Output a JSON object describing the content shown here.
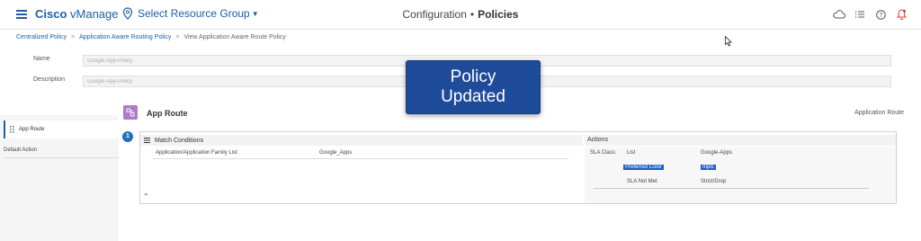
{
  "header": {
    "brand_bold": "Cisco",
    "brand_rest": " vManage",
    "resource_group": "Select Resource Group",
    "title_section": "Configuration",
    "title_bullet": "•",
    "title_page": "Policies"
  },
  "breadcrumb": {
    "items": [
      "Centralized Policy",
      "Application Aware Routing Policy",
      "View Application Aware Route Policy"
    ],
    "separator": ">"
  },
  "form": {
    "name_label": "Name",
    "name_value": "Google-App-Policy",
    "description_label": "Description",
    "description_value": "Google-App-Policy"
  },
  "sidebar": {
    "items": [
      {
        "label": "App Route",
        "selected": true
      },
      {
        "label": "Default Action",
        "selected": false
      }
    ]
  },
  "app_route": {
    "title": "App Route",
    "type_label": "Application Route",
    "sequence_number": "1"
  },
  "match_conditions": {
    "title": "Match Conditions",
    "rows": [
      {
        "key": "Application/Application Family List:",
        "value": "Google_Apps"
      }
    ]
  },
  "actions": {
    "title": "Actions",
    "sla_class_label": "SLA Class:",
    "list_label": "List",
    "list_value": "Google-Apps",
    "preferred_color_label": "Preferred Color",
    "preferred_color_value": "mpls",
    "sla_not_met_label": "SLA Not Met",
    "sla_not_met_value": "Strict/Drop"
  },
  "toast": {
    "line1": "Policy",
    "line2": "Updated"
  },
  "icons": {
    "menu": "hamburger-icon",
    "location": "map-pin-icon",
    "cloud": "cloud-icon",
    "tasks": "list-icon",
    "help": "help-icon",
    "alarm": "bell-icon"
  },
  "colors": {
    "brand": "#1e5fa8",
    "toast_bg": "#1f4b9b",
    "app_route_icon": "#b07ac9",
    "selection_highlight": "#1f5fc4",
    "alarm": "#e03a2f"
  }
}
